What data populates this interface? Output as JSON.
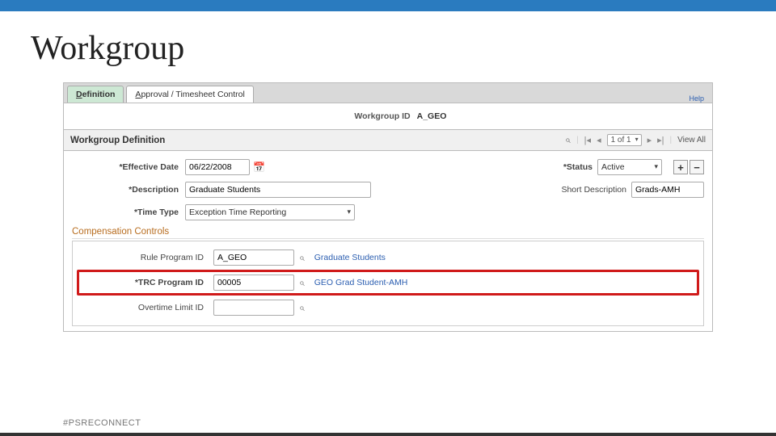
{
  "slide": {
    "title": "Workgroup",
    "hashtag": "#PSRECONNECT"
  },
  "tabs": {
    "active": "Definition",
    "other": "Approval / Timesheet Control",
    "active_ul": "D",
    "other_ul": "A"
  },
  "help": "Help",
  "workgroup_id": {
    "label": "Workgroup ID",
    "value": "A_GEO"
  },
  "section": {
    "title": "Workgroup Definition",
    "page_indicator": "1 of 1",
    "view_all": "View All"
  },
  "fields": {
    "eff_date": {
      "label": "Effective Date",
      "value": "06/22/2008"
    },
    "status": {
      "label": "Status",
      "value": "Active"
    },
    "description": {
      "label": "Description",
      "value": "Graduate Students"
    },
    "short_desc": {
      "label": "Short Description",
      "value": "Grads-AMH"
    },
    "time_type": {
      "label": "Time Type",
      "value": "Exception Time Reporting"
    }
  },
  "comp": {
    "header": "Compensation Controls",
    "rule": {
      "label": "Rule Program ID",
      "value": "A_GEO",
      "link": "Graduate Students"
    },
    "trc": {
      "label": "TRC Program ID",
      "value": "00005",
      "link": "GEO Grad Student-AMH"
    },
    "ot": {
      "label": "Overtime Limit ID",
      "value": ""
    }
  }
}
